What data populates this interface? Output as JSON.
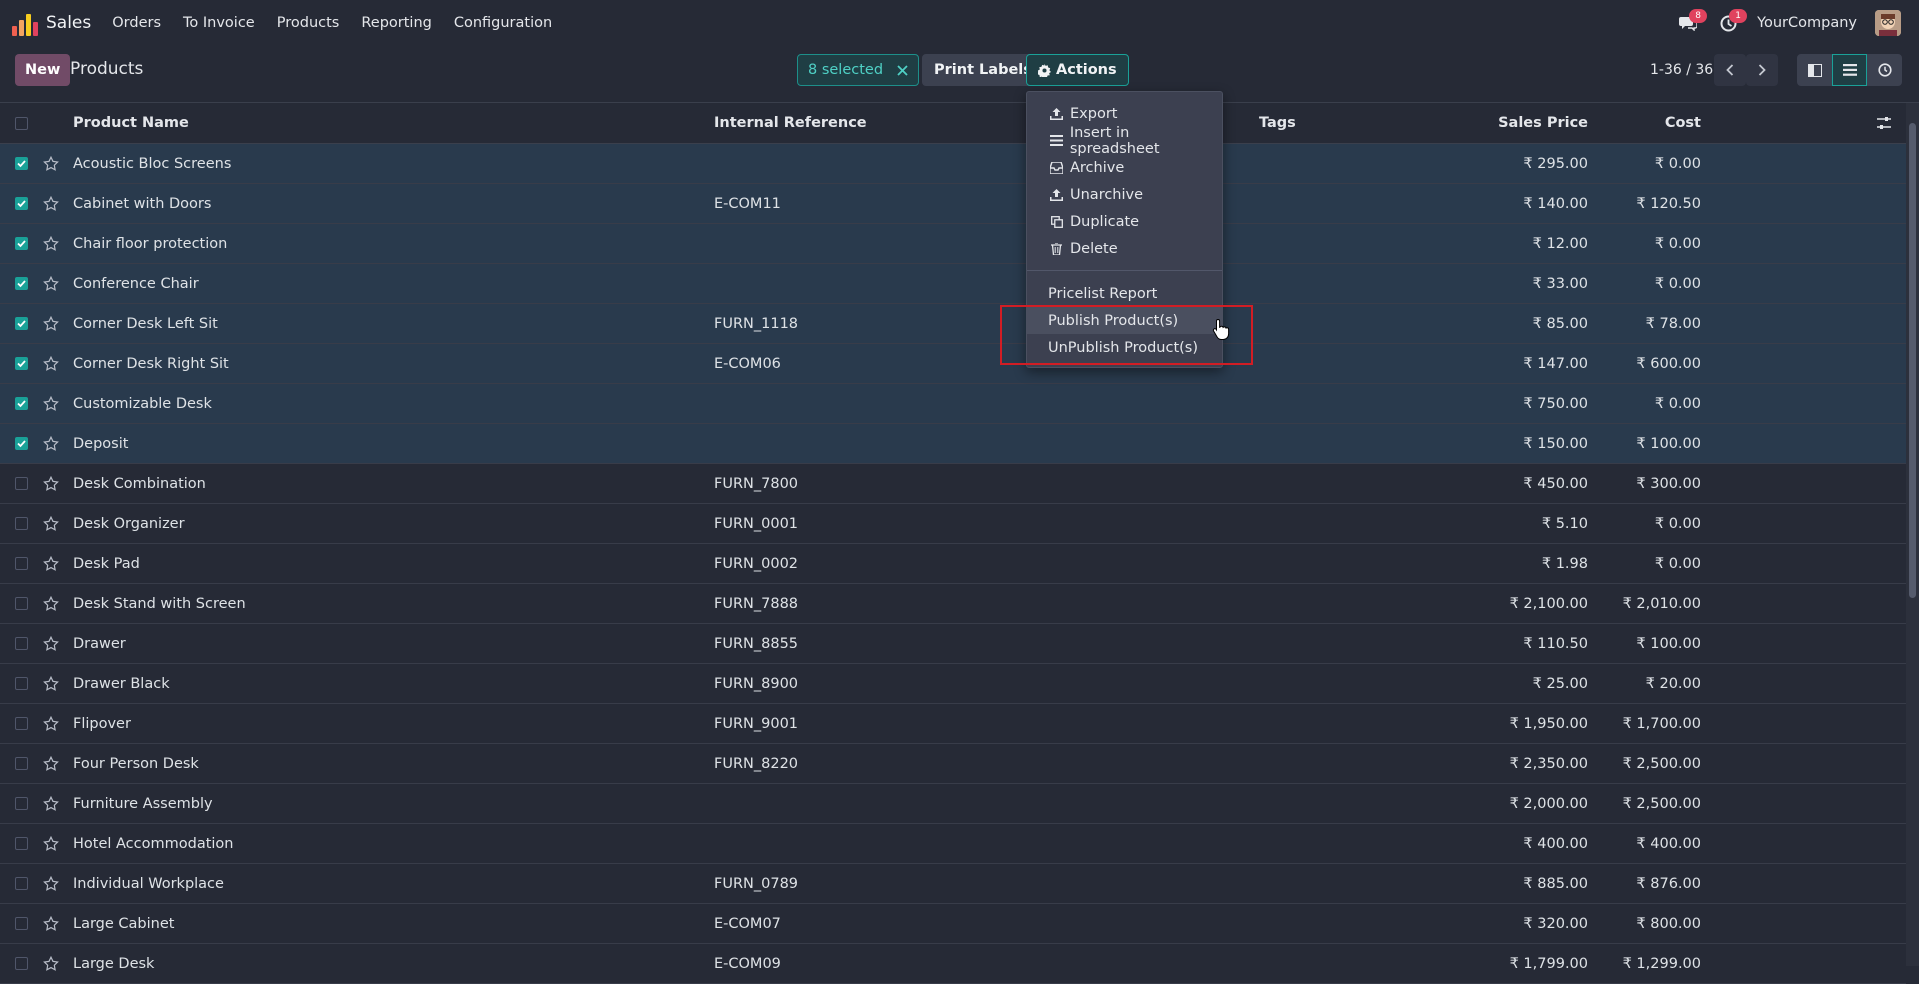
{
  "navbar": {
    "app_name": "Sales",
    "menu": [
      "Orders",
      "To Invoice",
      "Products",
      "Reporting",
      "Configuration"
    ],
    "messages_count": "8",
    "activities_count": "1",
    "company": "YourCompany"
  },
  "control_panel": {
    "new_label": "New",
    "title": "Products",
    "selected_label": "8 selected",
    "print_labels": "Print Labels",
    "actions_label": "Actions",
    "pager": "1-36 / 36"
  },
  "list": {
    "headers": {
      "name": "Product Name",
      "ref": "Internal Reference",
      "tags": "Tags",
      "price": "Sales Price",
      "cost": "Cost"
    },
    "rows": [
      {
        "name": "Acoustic Bloc Screens",
        "ref": "",
        "price": "₹ 295.00",
        "cost": "₹ 0.00",
        "selected": true
      },
      {
        "name": "Cabinet with Doors",
        "ref": "E-COM11",
        "price": "₹ 140.00",
        "cost": "₹ 120.50",
        "selected": true
      },
      {
        "name": "Chair floor protection",
        "ref": "",
        "price": "₹ 12.00",
        "cost": "₹ 0.00",
        "selected": true
      },
      {
        "name": "Conference Chair",
        "ref": "",
        "price": "₹ 33.00",
        "cost": "₹ 0.00",
        "selected": true
      },
      {
        "name": "Corner Desk Left Sit",
        "ref": "FURN_1118",
        "price": "₹ 85.00",
        "cost": "₹ 78.00",
        "selected": true
      },
      {
        "name": "Corner Desk Right Sit",
        "ref": "E-COM06",
        "price": "₹ 147.00",
        "cost": "₹ 600.00",
        "selected": true
      },
      {
        "name": "Customizable Desk",
        "ref": "",
        "price": "₹ 750.00",
        "cost": "₹ 0.00",
        "selected": true
      },
      {
        "name": "Deposit",
        "ref": "",
        "price": "₹ 150.00",
        "cost": "₹ 100.00",
        "selected": true
      },
      {
        "name": "Desk Combination",
        "ref": "FURN_7800",
        "price": "₹ 450.00",
        "cost": "₹ 300.00",
        "selected": false
      },
      {
        "name": "Desk Organizer",
        "ref": "FURN_0001",
        "price": "₹ 5.10",
        "cost": "₹ 0.00",
        "selected": false
      },
      {
        "name": "Desk Pad",
        "ref": "FURN_0002",
        "price": "₹ 1.98",
        "cost": "₹ 0.00",
        "selected": false
      },
      {
        "name": "Desk Stand with Screen",
        "ref": "FURN_7888",
        "price": "₹ 2,100.00",
        "cost": "₹ 2,010.00",
        "selected": false
      },
      {
        "name": "Drawer",
        "ref": "FURN_8855",
        "price": "₹ 110.50",
        "cost": "₹ 100.00",
        "selected": false
      },
      {
        "name": "Drawer Black",
        "ref": "FURN_8900",
        "price": "₹ 25.00",
        "cost": "₹ 20.00",
        "selected": false
      },
      {
        "name": "Flipover",
        "ref": "FURN_9001",
        "price": "₹ 1,950.00",
        "cost": "₹ 1,700.00",
        "selected": false
      },
      {
        "name": "Four Person Desk",
        "ref": "FURN_8220",
        "price": "₹ 2,350.00",
        "cost": "₹ 2,500.00",
        "selected": false
      },
      {
        "name": "Furniture Assembly",
        "ref": "",
        "price": "₹ 2,000.00",
        "cost": "₹ 2,500.00",
        "selected": false
      },
      {
        "name": "Hotel Accommodation",
        "ref": "",
        "price": "₹ 400.00",
        "cost": "₹ 400.00",
        "selected": false
      },
      {
        "name": "Individual Workplace",
        "ref": "FURN_0789",
        "price": "₹ 885.00",
        "cost": "₹ 876.00",
        "selected": false
      },
      {
        "name": "Large Cabinet",
        "ref": "E-COM07",
        "price": "₹ 320.00",
        "cost": "₹ 800.00",
        "selected": false
      },
      {
        "name": "Large Desk",
        "ref": "E-COM09",
        "price": "₹ 1,799.00",
        "cost": "₹ 1,299.00",
        "selected": false
      }
    ]
  },
  "actions_menu": {
    "items": [
      {
        "label": "Export",
        "icon": "upload-icon"
      },
      {
        "label": "Insert in spreadsheet",
        "icon": "list-icon"
      },
      {
        "label": "Archive",
        "icon": "inbox-icon"
      },
      {
        "label": "Unarchive",
        "icon": "upload-icon"
      },
      {
        "label": "Duplicate",
        "icon": "copy-icon"
      },
      {
        "label": "Delete",
        "icon": "trash-icon"
      }
    ],
    "extra": [
      "Pricelist Report",
      "Publish Product(s)",
      "UnPublish Product(s)"
    ],
    "hovered": "Publish Product(s)"
  },
  "colors": {
    "accent": "#1aa198",
    "brand": "#714b67",
    "background": "#262a36",
    "selected_row": "#293a4d",
    "highlight": "#d21d24"
  }
}
